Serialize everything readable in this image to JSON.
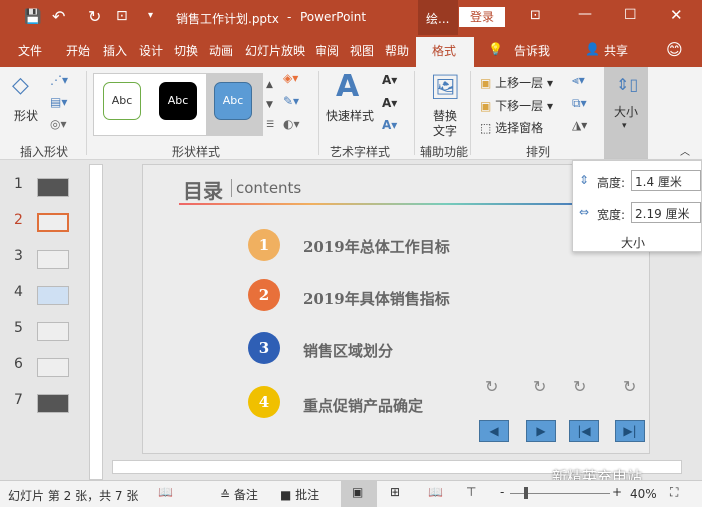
{
  "titlebar": {
    "filename": "销售工作计划.pptx",
    "sep": "-",
    "app": "PowerPoint",
    "context_tab": "绘...",
    "login": "登录"
  },
  "tabs": [
    "文件",
    "开始",
    "插入",
    "设计",
    "切换",
    "动画",
    "幻灯片放映",
    "审阅",
    "视图",
    "帮助",
    "格式"
  ],
  "tell_me": "告诉我",
  "share": "共享",
  "ribbon": {
    "insert_shape": {
      "label": "形状",
      "group": "插入形状"
    },
    "shape_styles": {
      "samples": [
        "Abc",
        "Abc",
        "Abc"
      ],
      "group": "形状样式"
    },
    "wordart": {
      "quick": "快速样式",
      "group": "艺术字样式"
    },
    "accessibility": {
      "alt_text": "替换\n文字",
      "alt1": "替换",
      "alt2": "文字",
      "group": "辅助功能"
    },
    "arrange": {
      "forward": "上移一层",
      "backward": "下移一层",
      "pane": "选择窗格",
      "group": "排列"
    },
    "size": {
      "label": "大小"
    }
  },
  "size_popup": {
    "height_label": "高度:",
    "height_value": "1.4 厘米",
    "width_label": "宽度:",
    "width_value": "2.19 厘米",
    "group": "大小"
  },
  "thumbs": [
    "1",
    "2",
    "3",
    "4",
    "5",
    "6",
    "7"
  ],
  "slide": {
    "title": "目录",
    "subtitle": "contents",
    "items": [
      {
        "num": "1",
        "text": "2019年总体工作目标",
        "color": "#f0b060"
      },
      {
        "num": "2",
        "text": "2019年具体销售指标",
        "color": "#e8703a"
      },
      {
        "num": "3",
        "text": "销售区域划分",
        "color": "#2f5fb5"
      },
      {
        "num": "4",
        "text": "重点促销产品确定",
        "color": "#f0c000"
      }
    ]
  },
  "status": {
    "slide_info": "幻灯片 第 2 张，共 7 张",
    "notes": "备注",
    "comments": "批注",
    "zoom": "40%",
    "minus": "-",
    "plus": "+"
  },
  "watermark": "新精英充电站"
}
